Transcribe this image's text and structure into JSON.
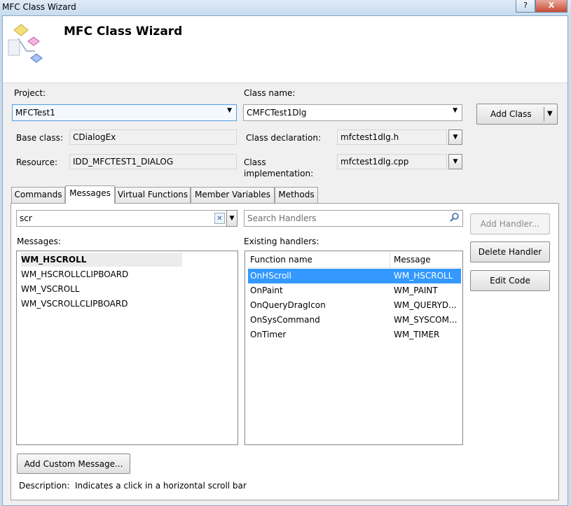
{
  "window": {
    "title": "MFC Class Wizard",
    "help_button": "?",
    "close_button": "X"
  },
  "header": {
    "title": "MFC Class Wizard"
  },
  "project": {
    "label": "Project:",
    "value": "MFCTest1"
  },
  "class_name": {
    "label": "Class name:",
    "value": "CMFCTest1Dlg"
  },
  "add_class_button": "Add Class",
  "base_class": {
    "label": "Base class:",
    "value": "CDialogEx"
  },
  "resource": {
    "label": "Resource:",
    "value": "IDD_MFCTEST1_DIALOG"
  },
  "class_declaration": {
    "label": "Class declaration:",
    "value": "mfctest1dlg.h"
  },
  "class_implementation": {
    "label_line1": "Class",
    "label_line2": "implementation:",
    "value": "mfctest1dlg.cpp"
  },
  "tabs": [
    {
      "label": "Commands"
    },
    {
      "label": "Messages"
    },
    {
      "label": "Virtual Functions"
    },
    {
      "label": "Member Variables"
    },
    {
      "label": "Methods"
    }
  ],
  "active_tab": "Messages",
  "messages_filter": {
    "value": "scr"
  },
  "search_handlers": {
    "placeholder": "Search Handlers"
  },
  "messages": {
    "label": "Messages:",
    "items": [
      "WM_HSCROLL",
      "WM_HSCROLLCLIPBOARD",
      "WM_VSCROLL",
      "WM_VSCROLLCLIPBOARD"
    ]
  },
  "existing_handlers": {
    "label": "Existing handlers:",
    "columns": [
      "Function name",
      "Message"
    ],
    "rows": [
      [
        "OnHScroll",
        "WM_HSCROLL"
      ],
      [
        "OnPaint",
        "WM_PAINT"
      ],
      [
        "OnQueryDragIcon",
        "WM_QUERYD..."
      ],
      [
        "OnSysCommand",
        "WM_SYSCOM..."
      ],
      [
        "OnTimer",
        "WM_TIMER"
      ]
    ]
  },
  "buttons": {
    "add_handler": "Add Handler...",
    "delete_handler": "Delete Handler",
    "edit_code": "Edit Code",
    "add_custom_message": "Add Custom Message..."
  },
  "description": {
    "label": "Description:",
    "text": "Indicates a click in a horizontal scroll bar"
  },
  "colors": {
    "selection": "#3399ff",
    "focus_border": "#569de5"
  }
}
